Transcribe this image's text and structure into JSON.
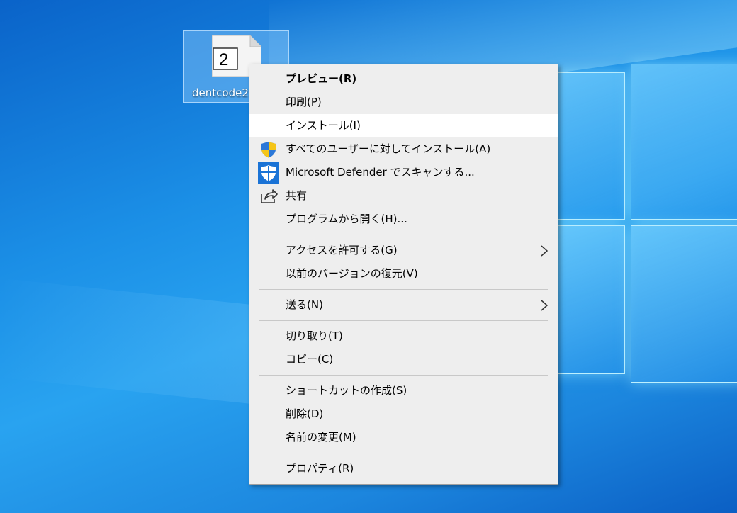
{
  "desktop": {
    "icon": {
      "badge": "2",
      "label": "dentcode2"
    }
  },
  "menu": {
    "items": [
      {
        "label": "プレビュー(R)",
        "bold": true,
        "icon": null
      },
      {
        "label": "印刷(P)",
        "icon": null
      },
      {
        "label": "インストール(I)",
        "icon": null,
        "highlighted": true
      },
      {
        "label": "すべてのユーザーに対してインストール(A)",
        "icon": "uac-shield-icon"
      },
      {
        "label": "Microsoft Defender でスキャンする...",
        "icon": "defender-icon"
      },
      {
        "label": "共有",
        "icon": "share-icon"
      },
      {
        "label": "プログラムから開く(H)...",
        "icon": null
      },
      {
        "label": "アクセスを許可する(G)",
        "submenu": true
      },
      {
        "label": "以前のバージョンの復元(V)"
      },
      {
        "label": "送る(N)",
        "submenu": true
      },
      {
        "label": "切り取り(T)"
      },
      {
        "label": "コピー(C)"
      },
      {
        "label": "ショートカットの作成(S)"
      },
      {
        "label": "削除(D)"
      },
      {
        "label": "名前の変更(M)"
      },
      {
        "label": "プロパティ(R)"
      }
    ]
  },
  "colors": {
    "menu_bg": "#eeeeee",
    "highlight": "#ffffff",
    "uac_blue": "#1a63c4",
    "uac_yellow": "#f5c518",
    "defender_blue": "#1a73d6"
  }
}
